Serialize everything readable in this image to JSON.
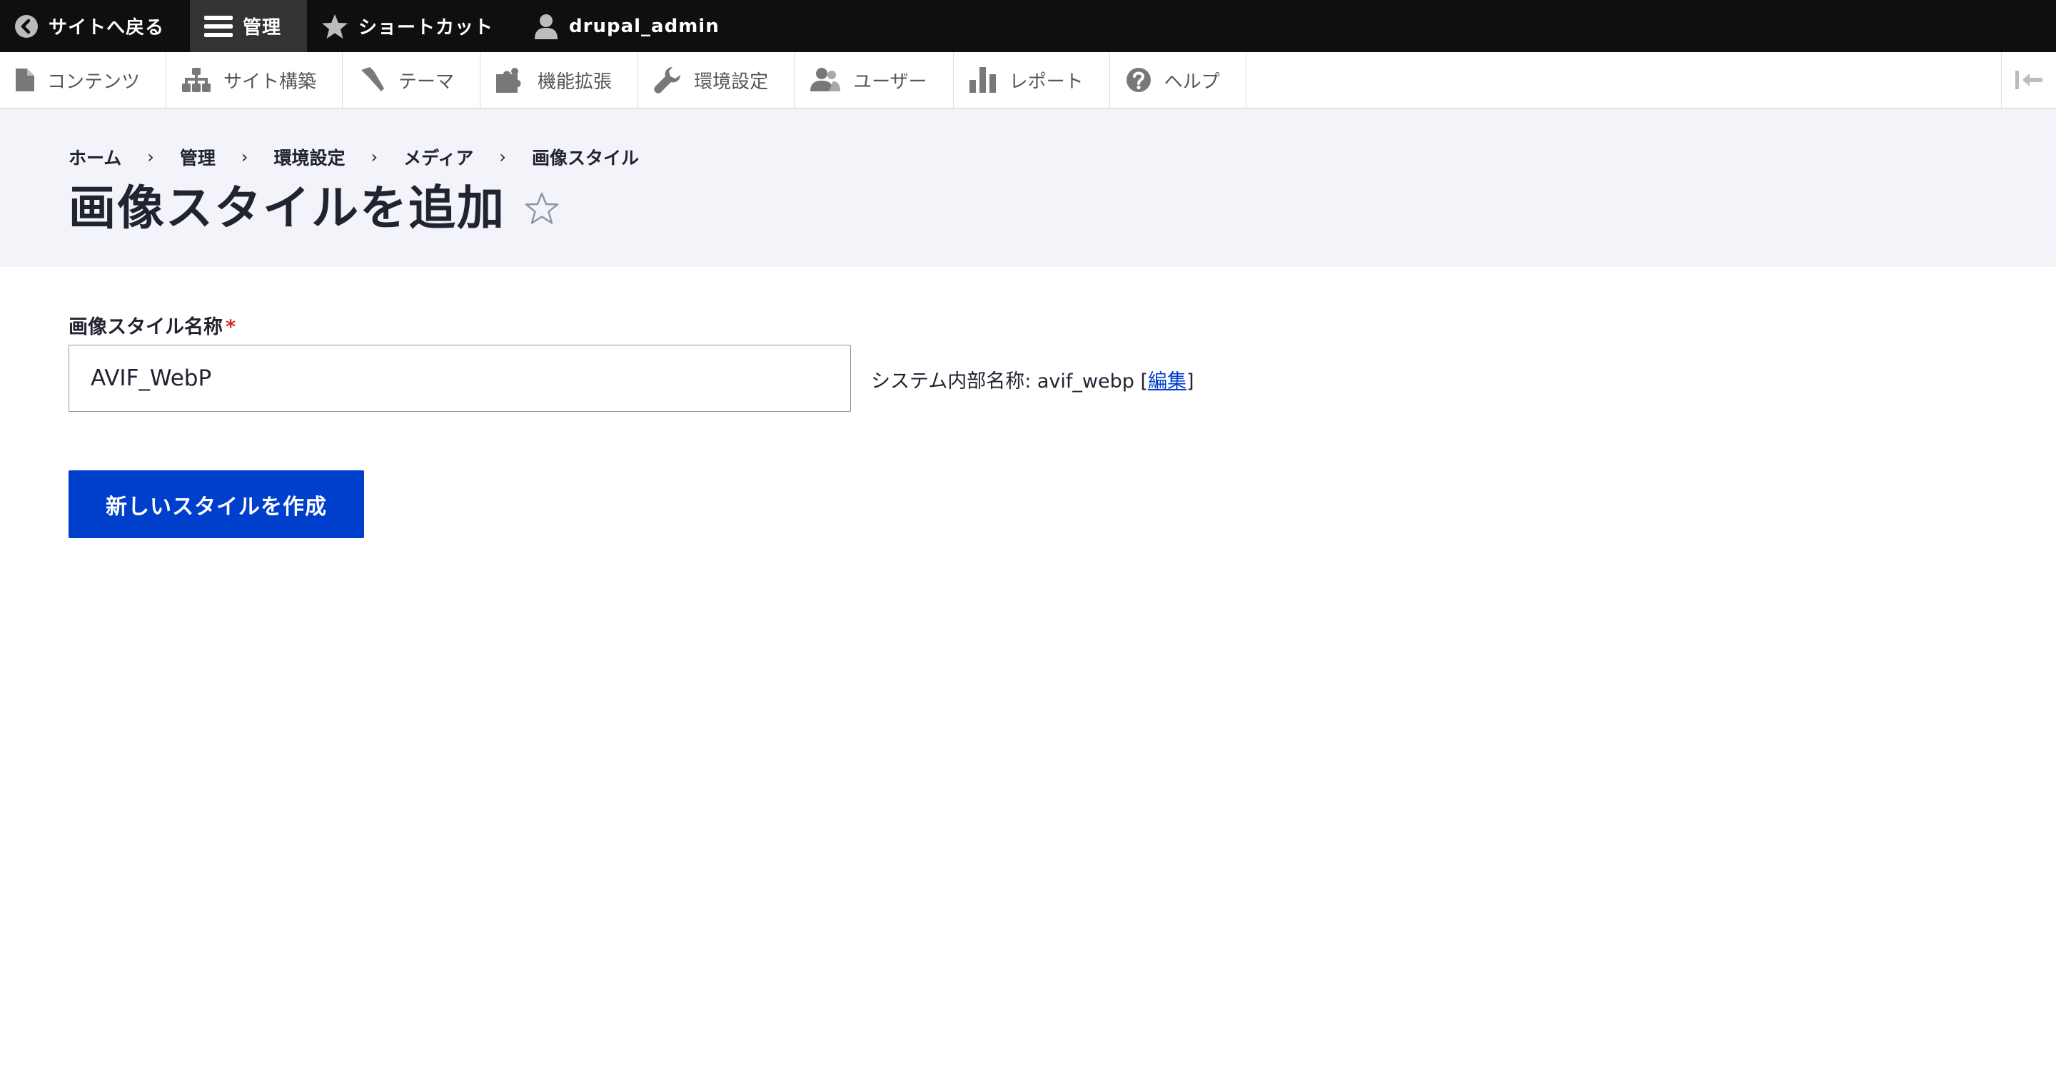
{
  "toolbar": {
    "back_to_site": "サイトへ戻る",
    "manage": "管理",
    "shortcuts": "ショートカット",
    "user": "drupal_admin"
  },
  "tray": {
    "items": [
      {
        "label": "コンテンツ",
        "icon": "file-icon"
      },
      {
        "label": "サイト構築",
        "icon": "sitemap-icon"
      },
      {
        "label": "テーマ",
        "icon": "paintbrush-icon"
      },
      {
        "label": "機能拡張",
        "icon": "puzzle-icon"
      },
      {
        "label": "環境設定",
        "icon": "wrench-icon"
      },
      {
        "label": "ユーザー",
        "icon": "people-icon"
      },
      {
        "label": "レポート",
        "icon": "bar-chart-icon"
      },
      {
        "label": "ヘルプ",
        "icon": "help-icon"
      }
    ]
  },
  "breadcrumb": [
    "ホーム",
    "管理",
    "環境設定",
    "メディア",
    "画像スタイル"
  ],
  "breadcrumb_separator": "›",
  "page": {
    "title": "画像スタイルを追加"
  },
  "form": {
    "label": "画像スタイル名称",
    "required_marker": "*",
    "value": "AVIF_WebP",
    "machine_name_prefix": "システム内部名称: avif_webp [",
    "machine_name_link": "編集",
    "machine_name_suffix": "]",
    "submit_label": "新しいスタイルを作成"
  },
  "colors": {
    "toolbar_bg": "#0f0f0f",
    "header_bg": "#f3f4f9",
    "primary_button": "#003ecc",
    "required": "#d72222",
    "link": "#003ecc"
  }
}
